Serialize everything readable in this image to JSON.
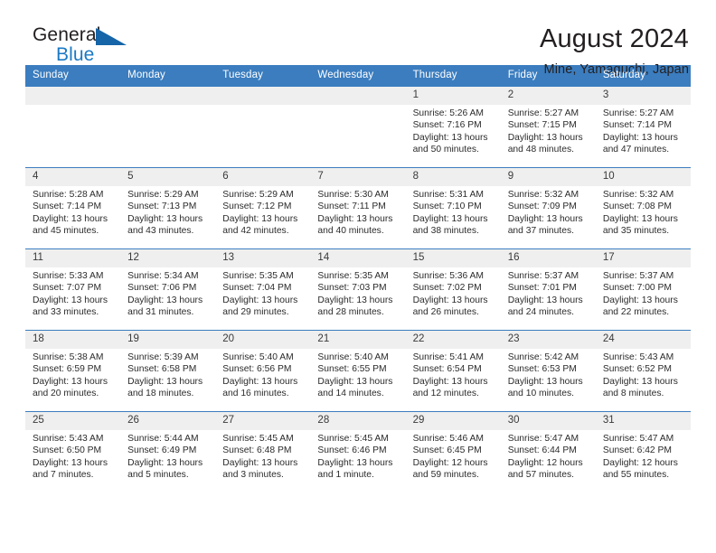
{
  "brand": {
    "name_top": "General",
    "name_bottom": "Blue",
    "accent_color": "#1a7ac4",
    "triangle_color": "#1565a8"
  },
  "header": {
    "title": "August 2024",
    "subtitle": "Mine, Yamaguchi, Japan"
  },
  "calendar": {
    "header_color": "#3b7dbf",
    "weekdays": [
      "Sunday",
      "Monday",
      "Tuesday",
      "Wednesday",
      "Thursday",
      "Friday",
      "Saturday"
    ],
    "weeks": [
      [
        {
          "day": "",
          "empty": true
        },
        {
          "day": "",
          "empty": true
        },
        {
          "day": "",
          "empty": true
        },
        {
          "day": "",
          "empty": true
        },
        {
          "day": "1",
          "sunrise": "Sunrise: 5:26 AM",
          "sunset": "Sunset: 7:16 PM",
          "daylight": "Daylight: 13 hours and 50 minutes."
        },
        {
          "day": "2",
          "sunrise": "Sunrise: 5:27 AM",
          "sunset": "Sunset: 7:15 PM",
          "daylight": "Daylight: 13 hours and 48 minutes."
        },
        {
          "day": "3",
          "sunrise": "Sunrise: 5:27 AM",
          "sunset": "Sunset: 7:14 PM",
          "daylight": "Daylight: 13 hours and 47 minutes."
        }
      ],
      [
        {
          "day": "4",
          "sunrise": "Sunrise: 5:28 AM",
          "sunset": "Sunset: 7:14 PM",
          "daylight": "Daylight: 13 hours and 45 minutes."
        },
        {
          "day": "5",
          "sunrise": "Sunrise: 5:29 AM",
          "sunset": "Sunset: 7:13 PM",
          "daylight": "Daylight: 13 hours and 43 minutes."
        },
        {
          "day": "6",
          "sunrise": "Sunrise: 5:29 AM",
          "sunset": "Sunset: 7:12 PM",
          "daylight": "Daylight: 13 hours and 42 minutes."
        },
        {
          "day": "7",
          "sunrise": "Sunrise: 5:30 AM",
          "sunset": "Sunset: 7:11 PM",
          "daylight": "Daylight: 13 hours and 40 minutes."
        },
        {
          "day": "8",
          "sunrise": "Sunrise: 5:31 AM",
          "sunset": "Sunset: 7:10 PM",
          "daylight": "Daylight: 13 hours and 38 minutes."
        },
        {
          "day": "9",
          "sunrise": "Sunrise: 5:32 AM",
          "sunset": "Sunset: 7:09 PM",
          "daylight": "Daylight: 13 hours and 37 minutes."
        },
        {
          "day": "10",
          "sunrise": "Sunrise: 5:32 AM",
          "sunset": "Sunset: 7:08 PM",
          "daylight": "Daylight: 13 hours and 35 minutes."
        }
      ],
      [
        {
          "day": "11",
          "sunrise": "Sunrise: 5:33 AM",
          "sunset": "Sunset: 7:07 PM",
          "daylight": "Daylight: 13 hours and 33 minutes."
        },
        {
          "day": "12",
          "sunrise": "Sunrise: 5:34 AM",
          "sunset": "Sunset: 7:06 PM",
          "daylight": "Daylight: 13 hours and 31 minutes."
        },
        {
          "day": "13",
          "sunrise": "Sunrise: 5:35 AM",
          "sunset": "Sunset: 7:04 PM",
          "daylight": "Daylight: 13 hours and 29 minutes."
        },
        {
          "day": "14",
          "sunrise": "Sunrise: 5:35 AM",
          "sunset": "Sunset: 7:03 PM",
          "daylight": "Daylight: 13 hours and 28 minutes."
        },
        {
          "day": "15",
          "sunrise": "Sunrise: 5:36 AM",
          "sunset": "Sunset: 7:02 PM",
          "daylight": "Daylight: 13 hours and 26 minutes."
        },
        {
          "day": "16",
          "sunrise": "Sunrise: 5:37 AM",
          "sunset": "Sunset: 7:01 PM",
          "daylight": "Daylight: 13 hours and 24 minutes."
        },
        {
          "day": "17",
          "sunrise": "Sunrise: 5:37 AM",
          "sunset": "Sunset: 7:00 PM",
          "daylight": "Daylight: 13 hours and 22 minutes."
        }
      ],
      [
        {
          "day": "18",
          "sunrise": "Sunrise: 5:38 AM",
          "sunset": "Sunset: 6:59 PM",
          "daylight": "Daylight: 13 hours and 20 minutes."
        },
        {
          "day": "19",
          "sunrise": "Sunrise: 5:39 AM",
          "sunset": "Sunset: 6:58 PM",
          "daylight": "Daylight: 13 hours and 18 minutes."
        },
        {
          "day": "20",
          "sunrise": "Sunrise: 5:40 AM",
          "sunset": "Sunset: 6:56 PM",
          "daylight": "Daylight: 13 hours and 16 minutes."
        },
        {
          "day": "21",
          "sunrise": "Sunrise: 5:40 AM",
          "sunset": "Sunset: 6:55 PM",
          "daylight": "Daylight: 13 hours and 14 minutes."
        },
        {
          "day": "22",
          "sunrise": "Sunrise: 5:41 AM",
          "sunset": "Sunset: 6:54 PM",
          "daylight": "Daylight: 13 hours and 12 minutes."
        },
        {
          "day": "23",
          "sunrise": "Sunrise: 5:42 AM",
          "sunset": "Sunset: 6:53 PM",
          "daylight": "Daylight: 13 hours and 10 minutes."
        },
        {
          "day": "24",
          "sunrise": "Sunrise: 5:43 AM",
          "sunset": "Sunset: 6:52 PM",
          "daylight": "Daylight: 13 hours and 8 minutes."
        }
      ],
      [
        {
          "day": "25",
          "sunrise": "Sunrise: 5:43 AM",
          "sunset": "Sunset: 6:50 PM",
          "daylight": "Daylight: 13 hours and 7 minutes."
        },
        {
          "day": "26",
          "sunrise": "Sunrise: 5:44 AM",
          "sunset": "Sunset: 6:49 PM",
          "daylight": "Daylight: 13 hours and 5 minutes."
        },
        {
          "day": "27",
          "sunrise": "Sunrise: 5:45 AM",
          "sunset": "Sunset: 6:48 PM",
          "daylight": "Daylight: 13 hours and 3 minutes."
        },
        {
          "day": "28",
          "sunrise": "Sunrise: 5:45 AM",
          "sunset": "Sunset: 6:46 PM",
          "daylight": "Daylight: 13 hours and 1 minute."
        },
        {
          "day": "29",
          "sunrise": "Sunrise: 5:46 AM",
          "sunset": "Sunset: 6:45 PM",
          "daylight": "Daylight: 12 hours and 59 minutes."
        },
        {
          "day": "30",
          "sunrise": "Sunrise: 5:47 AM",
          "sunset": "Sunset: 6:44 PM",
          "daylight": "Daylight: 12 hours and 57 minutes."
        },
        {
          "day": "31",
          "sunrise": "Sunrise: 5:47 AM",
          "sunset": "Sunset: 6:42 PM",
          "daylight": "Daylight: 12 hours and 55 minutes."
        }
      ]
    ]
  }
}
